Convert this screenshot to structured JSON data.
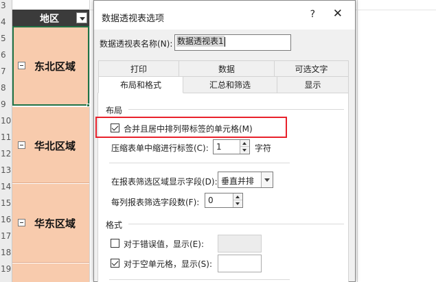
{
  "sheet": {
    "row_numbers": [
      "3",
      "4",
      "5",
      "6",
      "7",
      "8",
      "9",
      "10",
      "11",
      "12",
      "13",
      "14",
      "15",
      "16",
      "17",
      "18",
      "19"
    ],
    "column_header": "地区",
    "regions": [
      "东北区域",
      "华北区域",
      "华东区域"
    ]
  },
  "dialog": {
    "title": "数据透视表选项",
    "help_label": "?",
    "close_label": "✕",
    "name_label": "数据透视表名称(N):",
    "name_value": "数据透视表1",
    "tabs_row1": [
      "打印",
      "数据",
      "可选文字"
    ],
    "tabs_row2": [
      "布局和格式",
      "汇总和筛选",
      "显示"
    ],
    "active_tab": "布局和格式",
    "layout": {
      "section_title": "布局",
      "merge_label": "合并且居中排列带标签的单元格(M)",
      "merge_checked": true,
      "indent_label": "压缩表单中缩进行标签(C):",
      "indent_value": "1",
      "indent_unit": "字符",
      "filter_area_label": "在报表筛选区域显示字段(D):",
      "filter_area_value": "垂直并排",
      "fields_per_column_label": "每列报表筛选字段数(F):",
      "fields_per_column_value": "0"
    },
    "format": {
      "section_title": "格式",
      "error_label": "对于错误值，显示(E):",
      "error_checked": false,
      "empty_label": "对于空单元格，显示(S):",
      "empty_checked": true
    },
    "colors": {
      "highlight_border": "#e8202a",
      "region_fill": "#f8cbad",
      "header_fill": "#3b3b3b"
    }
  }
}
